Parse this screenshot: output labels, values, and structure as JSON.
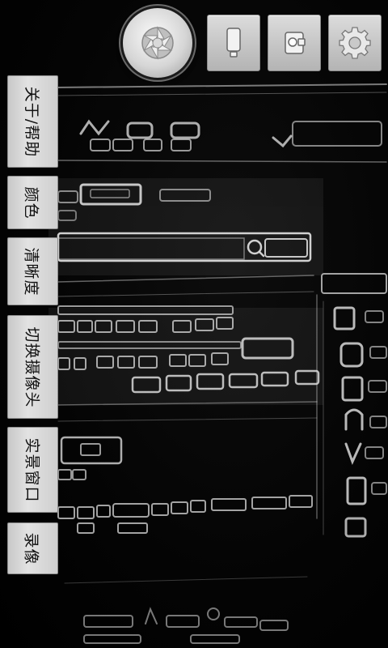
{
  "toolbar": {
    "shutter_icon": "aperture-icon",
    "buttons": [
      {
        "icon": "portrait-mode-icon"
      },
      {
        "icon": "camera-switch-icon"
      },
      {
        "icon": "gear-icon"
      }
    ]
  },
  "side_menu": [
    {
      "label": "关于/帮助"
    },
    {
      "label": "颜色"
    },
    {
      "label": "清晰度"
    },
    {
      "label": "切换摄像头"
    },
    {
      "label": "实景窗口"
    },
    {
      "label": "录像"
    }
  ],
  "colors": {
    "button_face": "#d2d2d2",
    "background": "#030303",
    "edge_glow": "#e8e8e8"
  }
}
